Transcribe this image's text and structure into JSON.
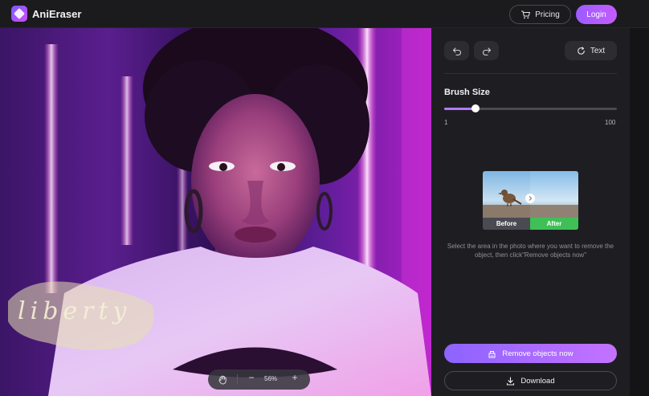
{
  "header": {
    "app_title": "AniEraser",
    "pricing_label": "Pricing",
    "login_label": "Login",
    "logo_icon": "anieraser-logo-icon"
  },
  "canvas": {
    "watermark_text": "liberty",
    "zoom": {
      "level": "56%",
      "minus_label": "−",
      "plus_label": "+"
    }
  },
  "sidebar": {
    "undo_icon": "undo-icon",
    "redo_icon": "redo-icon",
    "text_label": "Text",
    "brush": {
      "label": "Brush Size",
      "min": "1",
      "max": "100",
      "value_fraction": 0.18
    },
    "demo": {
      "before_label": "Before",
      "after_label": "After"
    },
    "hint": "Select the area in the photo where you want to remove the object, then click\"Remove objects now\"",
    "remove_label": "Remove objects now",
    "download_label": "Download"
  },
  "colors": {
    "accent": "#b07bff",
    "panel": "#1e1e22",
    "after_green": "#3fbf56"
  }
}
